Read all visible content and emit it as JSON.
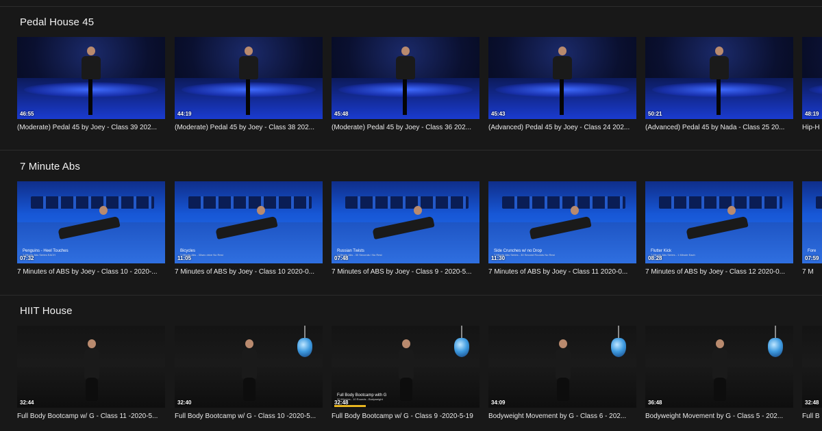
{
  "shelves": [
    {
      "title": "Pedal House 45",
      "theme": "spin",
      "cards": [
        {
          "title": "(Moderate) Pedal 45 by Joey - Class 39 202...",
          "duration": "46:55",
          "overlay1": "",
          "overlay2": ""
        },
        {
          "title": "(Moderate) Pedal 45 by Joey - Class 38 202...",
          "duration": "44:19",
          "overlay1": "",
          "overlay2": ""
        },
        {
          "title": "(Moderate) Pedal 45 by Joey - Class 36 202...",
          "duration": "45:48",
          "overlay1": "",
          "overlay2": ""
        },
        {
          "title": "(Advanced) Pedal 45 by Joey - Class 24 202...",
          "duration": "45:43",
          "overlay1": "",
          "overlay2": ""
        },
        {
          "title": "(Advanced) Pedal 45 by Nada - Class 25 20...",
          "duration": "50:21",
          "overlay1": "",
          "overlay2": ""
        },
        {
          "title": "Hip-H",
          "duration": "48:19",
          "overlay1": "",
          "overlay2": ""
        }
      ]
    },
    {
      "title": "7 Minute Abs",
      "theme": "abs",
      "cards": [
        {
          "title": "7 Minutes of ABS by Joey - Class 10 - 2020-...",
          "duration": "07:32",
          "overlay1": "Penguins - Heel Touches",
          "overlay2": "7 Minute Abs Series EACH"
        },
        {
          "title": "7 Minutes of ABS by Joey - Class 10 2020-0...",
          "duration": "11:05",
          "overlay1": "Bicycles",
          "overlay2": "7 Minute Abs - 30sec drive No Rest"
        },
        {
          "title": "7 Minutes of ABS by Joey - Class 9 - 2020-5...",
          "duration": "07:48",
          "overlay1": "Russian Twists",
          "overlay2": "7 Minute Abs - 30 Seconds / No Rest"
        },
        {
          "title": "7 Minutes of ABS by Joey - Class 11 2020-0...",
          "duration": "11:30",
          "overlay1": "Side Crunches w/ no Drop",
          "overlay2": "7 Minute Abs Series - 30 Second Rounds No Rest"
        },
        {
          "title": "7 Minutes of ABS by Joey - Class 12 2020-0...",
          "duration": "08:28",
          "overlay1": "Flutter Kick",
          "overlay2": "7 Minute Abs Series - 1 Minute Each"
        },
        {
          "title": "7 M",
          "duration": "07:59",
          "overlay1": "Fore",
          "overlay2": ""
        }
      ]
    },
    {
      "title": "HIIT House",
      "theme": "hiit",
      "cards": [
        {
          "title": "Full Body Bootcamp w/ G - Class 11 -2020-5...",
          "duration": "32:44",
          "overlay1": "",
          "overlay2": "",
          "progress": 0
        },
        {
          "title": "Full Body Bootcamp w/ G - Class 10 -2020-5...",
          "duration": "32:40",
          "overlay1": "",
          "overlay2": "",
          "progress": 0
        },
        {
          "title": "Full Body Bootcamp w/ G - Class 9 -2020-5-19",
          "duration": "32:48",
          "overlay1": "Full Body Bootcamp with G",
          "overlay2": "30 Minutes - 10 Rounds - Bodyweight",
          "progress": 0.22
        },
        {
          "title": "Bodyweight Movement by G - Class 6 - 202...",
          "duration": "34:09",
          "overlay1": "",
          "overlay2": "",
          "progress": 0
        },
        {
          "title": "Bodyweight Movement by G - Class 5 - 202...",
          "duration": "36:48",
          "overlay1": "",
          "overlay2": "",
          "progress": 0
        },
        {
          "title": "Full B",
          "duration": "32:48",
          "overlay1": "",
          "overlay2": "",
          "progress": 0
        }
      ]
    }
  ]
}
